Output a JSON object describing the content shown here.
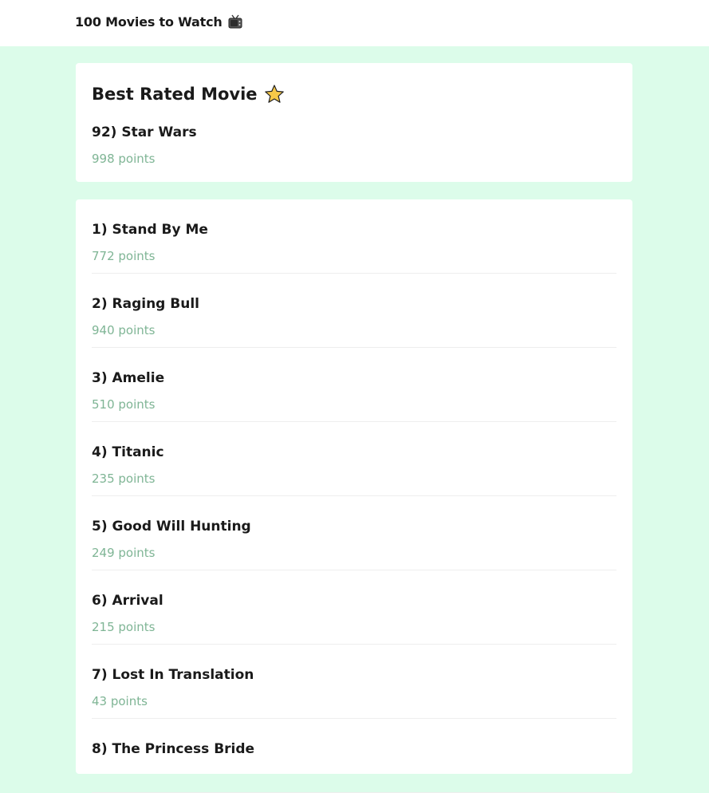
{
  "header": {
    "title": "100 Movies to Watch",
    "icon": "tv-icon"
  },
  "best": {
    "heading": "Best Rated Movie",
    "heading_icon": "star-icon",
    "name": "92) Star Wars",
    "points": "998 points"
  },
  "movies": [
    {
      "name": "1) Stand By Me",
      "points": "772 points"
    },
    {
      "name": "2) Raging Bull",
      "points": "940 points"
    },
    {
      "name": "3) Amelie",
      "points": "510 points"
    },
    {
      "name": "4) Titanic",
      "points": "235 points"
    },
    {
      "name": "5) Good Will Hunting",
      "points": "249 points"
    },
    {
      "name": "6) Arrival",
      "points": "215 points"
    },
    {
      "name": "7) Lost In Translation",
      "points": "43 points"
    },
    {
      "name": "8) The Princess Bride",
      "points": ""
    }
  ],
  "colors": {
    "background": "#dcfcea",
    "points_text": "#7fb595",
    "star_fill": "#f7c948"
  }
}
